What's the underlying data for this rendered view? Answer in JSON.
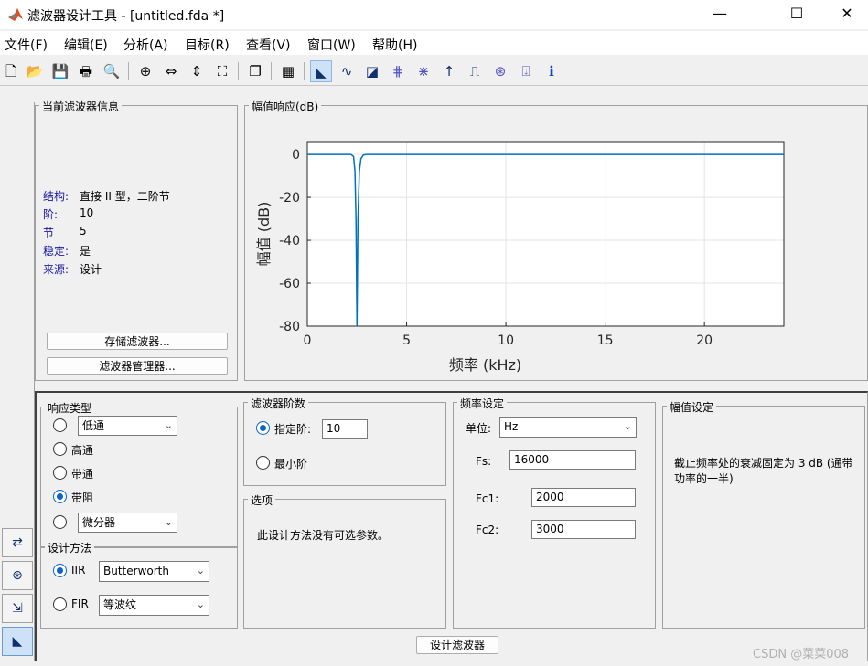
{
  "window": {
    "title": "滤波器设计工具 - [untitled.fda *]",
    "minimize": "—",
    "maximize": "☐",
    "close": "✕"
  },
  "menu": [
    "文件(F)",
    "编辑(E)",
    "分析(A)",
    "目标(R)",
    "查看(V)",
    "窗口(W)",
    "帮助(H)"
  ],
  "toolbar": [
    {
      "icon": "new-file-icon",
      "glyph": "🗋"
    },
    {
      "icon": "open-folder-icon",
      "glyph": "📂"
    },
    {
      "icon": "save-icon",
      "glyph": "💾"
    },
    {
      "icon": "print-icon",
      "glyph": "🖶"
    },
    {
      "icon": "print-preview-icon",
      "glyph": "🔍"
    },
    {
      "icon": "zoom-in-icon",
      "glyph": "⊕"
    },
    {
      "icon": "zoom-x-icon",
      "glyph": "⇔"
    },
    {
      "icon": "zoom-y-icon",
      "glyph": "⇕"
    },
    {
      "icon": "full-view-icon",
      "glyph": "⛶"
    },
    {
      "icon": "new-figure-icon",
      "glyph": "❐"
    },
    {
      "icon": "filter-specs-icon",
      "glyph": "▦"
    },
    {
      "icon": "magnitude-response-icon",
      "glyph": "◣",
      "active": true
    },
    {
      "icon": "phase-response-icon",
      "glyph": "∿"
    },
    {
      "icon": "magnitude-phase-icon",
      "glyph": "◪"
    },
    {
      "icon": "group-delay-icon",
      "glyph": "⋕"
    },
    {
      "icon": "phase-delay-icon",
      "glyph": "⋇"
    },
    {
      "icon": "impulse-response-icon",
      "glyph": "↑"
    },
    {
      "icon": "step-response-icon",
      "glyph": "⎍"
    },
    {
      "icon": "pole-zero-icon",
      "glyph": "⊛"
    },
    {
      "icon": "filter-coefficients-icon",
      "glyph": "⍗"
    },
    {
      "icon": "filter-info-icon",
      "glyph": "ℹ"
    }
  ],
  "filter_info": {
    "title": "当前滤波器信息",
    "rows": [
      {
        "key": "结构:",
        "value": "直接 II 型，二阶节"
      },
      {
        "key": "阶:",
        "value": "10"
      },
      {
        "key": "节",
        "value": "5"
      },
      {
        "key": "稳定:",
        "value": "是"
      },
      {
        "key": "来源:",
        "value": "设计"
      }
    ],
    "store_button": "存储滤波器...",
    "manager_button": "滤波器管理器..."
  },
  "plot_panel": {
    "title": "幅值响应(dB)"
  },
  "chart_data": {
    "type": "line",
    "title": "",
    "xlabel": "频率 (kHz)",
    "ylabel": "幅值 (dB)",
    "xlim": [
      0,
      24
    ],
    "ylim": [
      -80,
      6
    ],
    "xticks": [
      0,
      5,
      10,
      15,
      20
    ],
    "yticks": [
      0,
      -20,
      -40,
      -60,
      -80
    ],
    "grid": true,
    "series_color": "#0072bd",
    "x": [
      0,
      2.2,
      2.33,
      2.4,
      2.45,
      2.48,
      2.5,
      2.52,
      2.55,
      2.62,
      2.7,
      2.82,
      3.0,
      24
    ],
    "y": [
      0,
      0,
      -1,
      -8,
      -30,
      -60,
      -80,
      -60,
      -30,
      -8,
      -2,
      -0.3,
      0,
      0
    ]
  },
  "response_type": {
    "title": "响应类型",
    "options": [
      {
        "label": "低通",
        "selected": false,
        "dropdown": true
      },
      {
        "label": "高通",
        "selected": false
      },
      {
        "label": "带通",
        "selected": false
      },
      {
        "label": "带阻",
        "selected": true
      },
      {
        "label": "微分器",
        "selected": false,
        "dropdown": true
      }
    ]
  },
  "design_method": {
    "title": "设计方法",
    "iir_label": "IIR",
    "iir_selected": true,
    "iir_value": "Butterworth",
    "fir_label": "FIR",
    "fir_selected": false,
    "fir_value": "等波纹"
  },
  "filter_order": {
    "title": "滤波器阶数",
    "specify_label": "指定阶:",
    "specify_value": "10",
    "specify_selected": true,
    "minimum_label": "最小阶",
    "minimum_selected": false
  },
  "options": {
    "title": "选项",
    "text": "此设计方法没有可选参数。"
  },
  "freq_specs": {
    "title": "频率设定",
    "units_label": "单位:",
    "units_value": "Hz",
    "fs_label": "Fs:",
    "fs_value": "16000",
    "fc1_label": "Fc1:",
    "fc1_value": "2000",
    "fc2_label": "Fc2:",
    "fc2_value": "3000"
  },
  "mag_specs": {
    "title": "幅值设定",
    "text": "截止频率处的衰减固定为 3 dB (通带功率的一半)"
  },
  "design_button": "设计滤波器",
  "watermark": "CSDN @菜菜008",
  "side_toolbar": [
    {
      "icon": "transform-filter-icon",
      "glyph": "⇄"
    },
    {
      "icon": "pole-zero-editor-icon",
      "glyph": "⊛"
    },
    {
      "icon": "import-filter-icon",
      "glyph": "⇲"
    },
    {
      "icon": "design-filter-icon",
      "glyph": "◣",
      "active": true
    }
  ]
}
